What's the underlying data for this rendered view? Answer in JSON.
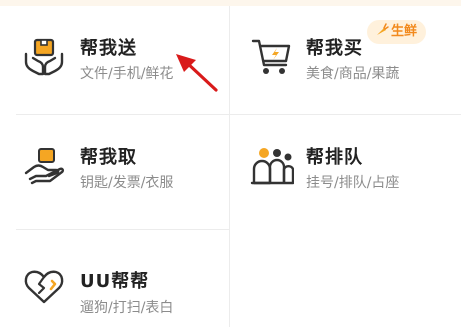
{
  "services": [
    {
      "title": "帮我送",
      "subtitle": "文件/手机/鲜花",
      "icon": "box-hands-icon"
    },
    {
      "title": "帮我买",
      "subtitle": "美食/商品/果蔬",
      "icon": "shopping-cart-icon",
      "badge": "生鲜"
    },
    {
      "title": "帮我取",
      "subtitle": "钥匙/发票/衣服",
      "icon": "hand-package-icon"
    },
    {
      "title": "帮排队",
      "subtitle": "挂号/排队/占座",
      "icon": "queue-people-icon"
    },
    {
      "title": "UU帮帮",
      "subtitle": "遛狗/打扫/表白",
      "icon": "heart-hand-icon"
    }
  ],
  "colors": {
    "accent": "#f5a623",
    "badge_bg": "#fff1dc",
    "badge_text": "#f28a1e",
    "annotation_arrow": "#d91a1a"
  }
}
